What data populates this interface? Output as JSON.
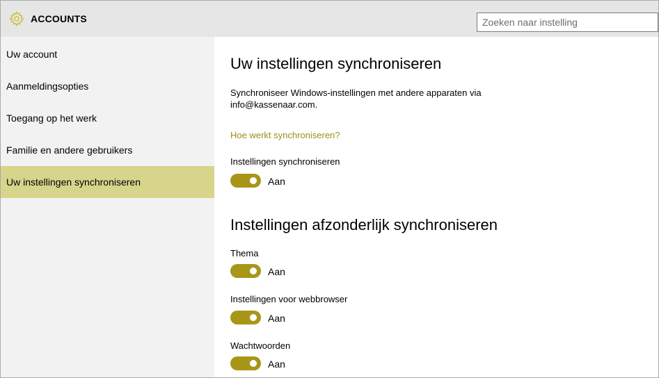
{
  "header": {
    "title": "ACCOUNTS",
    "search_placeholder": "Zoeken naar instelling",
    "icon": "gear-icon",
    "accent": "#c7b91d"
  },
  "sidebar": {
    "items": [
      {
        "label": "Uw account",
        "active": false
      },
      {
        "label": "Aanmeldingsopties",
        "active": false
      },
      {
        "label": "Toegang op het werk",
        "active": false
      },
      {
        "label": "Familie en andere gebruikers",
        "active": false
      },
      {
        "label": "Uw instellingen synchroniseren",
        "active": true
      }
    ],
    "active_color": "#d7d48b"
  },
  "main": {
    "title": "Uw instellingen synchroniseren",
    "description_line1": "Synchroniseer Windows-instellingen met andere apparaten via",
    "description_line2": "info@kassenaar.com.",
    "help_link": "Hoe werkt synchroniseren?",
    "sync_setting": {
      "label": "Instellingen synchroniseren",
      "state": "Aan",
      "on": true
    },
    "section_title": "Instellingen afzonderlijk synchroniseren",
    "individual": [
      {
        "label": "Thema",
        "state": "Aan",
        "on": true
      },
      {
        "label": "Instellingen voor webbrowser",
        "state": "Aan",
        "on": true
      },
      {
        "label": "Wachtwoorden",
        "state": "Aan",
        "on": true
      }
    ],
    "toggle_color": "#a89619",
    "link_color": "#9b8f17"
  }
}
